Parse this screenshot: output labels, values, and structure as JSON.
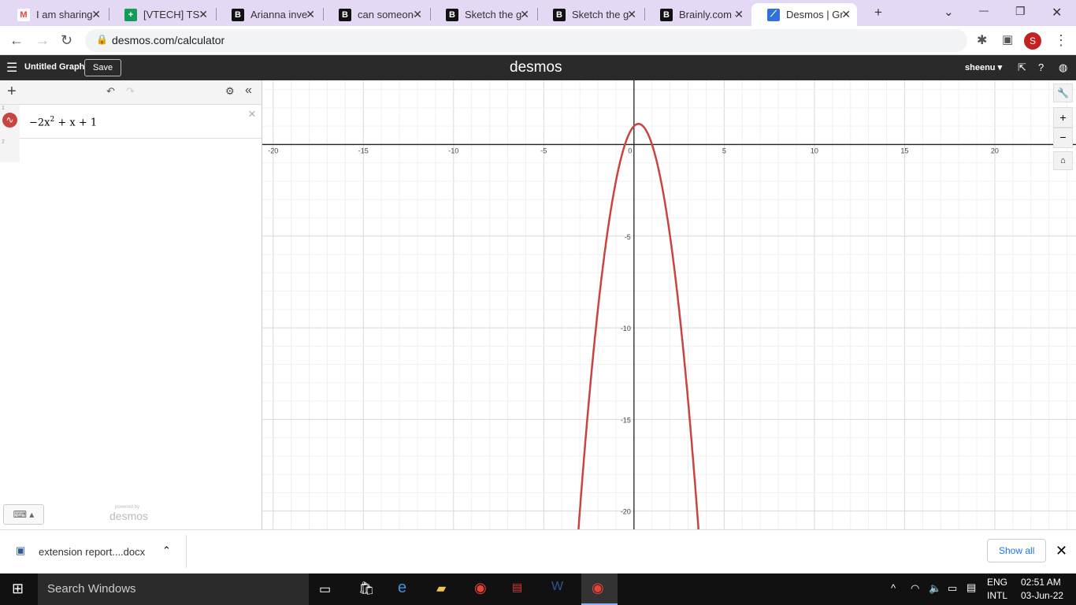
{
  "browser": {
    "tabs": [
      {
        "label": "I am sharing",
        "icon": "gmail-icon"
      },
      {
        "label": "[VTECH] TSR",
        "icon": "sheets-icon"
      },
      {
        "label": "Arianna inves",
        "icon": "brainly-icon"
      },
      {
        "label": "can someone",
        "icon": "brainly-icon"
      },
      {
        "label": "Sketch the gr",
        "icon": "brainly-icon"
      },
      {
        "label": "Sketch the gr",
        "icon": "brainly-icon"
      },
      {
        "label": "Brainly.com -",
        "icon": "brainly-icon"
      },
      {
        "label": "Desmos | Gra",
        "icon": "desmos-icon",
        "active": true
      }
    ],
    "url": "desmos.com/calculator",
    "profile": "S"
  },
  "desmos": {
    "title": "Untitled Graph",
    "save": "Save",
    "logo": "desmos",
    "user": "sheenu",
    "powered": "powered by",
    "powered_logo": "desmos",
    "expressions": [
      {
        "index": "1",
        "latex_parts": [
          "−2x",
          "2",
          " + x + 1"
        ],
        "color": "#c74440"
      },
      {
        "index": "2"
      }
    ]
  },
  "graph": {
    "x_ticks": [
      "-20",
      "-15",
      "-10",
      "-5",
      "0",
      "5",
      "10",
      "15",
      "20"
    ],
    "y_ticks": [
      "-5",
      "-10",
      "-15",
      "-20"
    ],
    "xlim": [
      -20.6,
      24.5
    ],
    "ylim": [
      -21,
      3.5
    ],
    "function": {
      "a": -2,
      "b": 1,
      "c": 1
    },
    "curve_color": "#c74440"
  },
  "download": {
    "file": "extension report....docx",
    "show_all": "Show all"
  },
  "taskbar": {
    "search": "Search Windows",
    "lang1": "ENG",
    "lang2": "INTL",
    "time": "02:51 AM",
    "date": "03-Jun-22"
  }
}
